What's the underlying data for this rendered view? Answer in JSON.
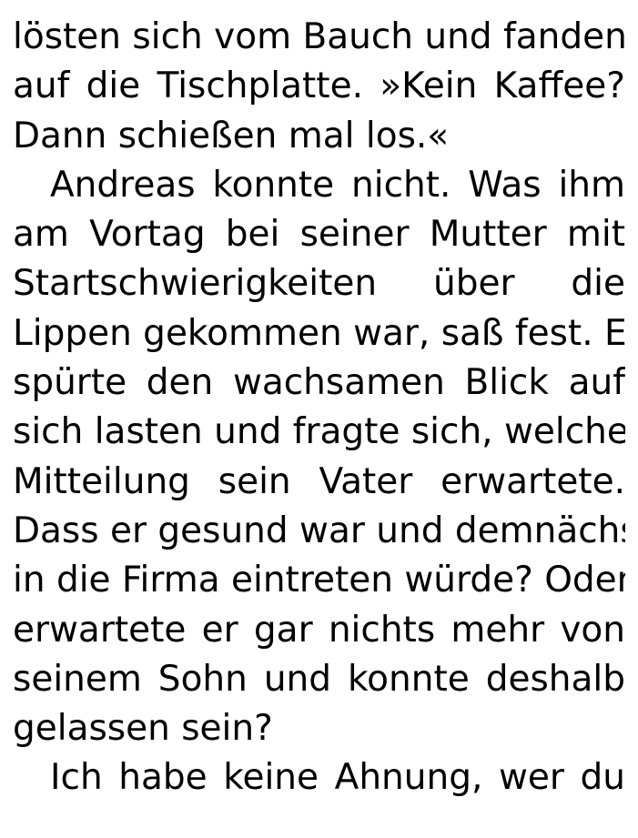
{
  "document": {
    "lines": [
      {
        "text": "lösten sich vom Bauch und fanden",
        "indent": false,
        "last": false
      },
      {
        "text": "auf die Tischplatte. »Kein Kaffee?",
        "indent": false,
        "last": false
      },
      {
        "text": "Dann schießen mal los.«",
        "indent": false,
        "last": true
      },
      {
        "text": "Andreas konnte nicht. Was ihm",
        "indent": true,
        "last": false
      },
      {
        "text": "am Vortag bei seiner Mutter mit",
        "indent": false,
        "last": false
      },
      {
        "text": "Startschwierigkeiten über die",
        "indent": false,
        "last": false
      },
      {
        "text": "Lippen gekommen war, saß fest. Er",
        "indent": false,
        "last": false
      },
      {
        "text": "spürte den wachsamen Blick auf",
        "indent": false,
        "last": false
      },
      {
        "text": "sich lasten und fragte sich, welche",
        "indent": false,
        "last": false
      },
      {
        "text": "Mitteilung sein Vater erwartete.",
        "indent": false,
        "last": false
      },
      {
        "text": "Dass er gesund war und demnächst",
        "indent": false,
        "last": false
      },
      {
        "text": "in die Firma eintreten würde? Oder",
        "indent": false,
        "last": false
      },
      {
        "text": "erwartete er gar nichts mehr von",
        "indent": false,
        "last": false
      },
      {
        "text": "seinem Sohn und konnte deshalb",
        "indent": false,
        "last": false
      },
      {
        "text": "gelassen sein?",
        "indent": false,
        "last": true
      },
      {
        "text": "Ich habe keine Ahnung, wer du",
        "indent": true,
        "last": false
      }
    ]
  }
}
